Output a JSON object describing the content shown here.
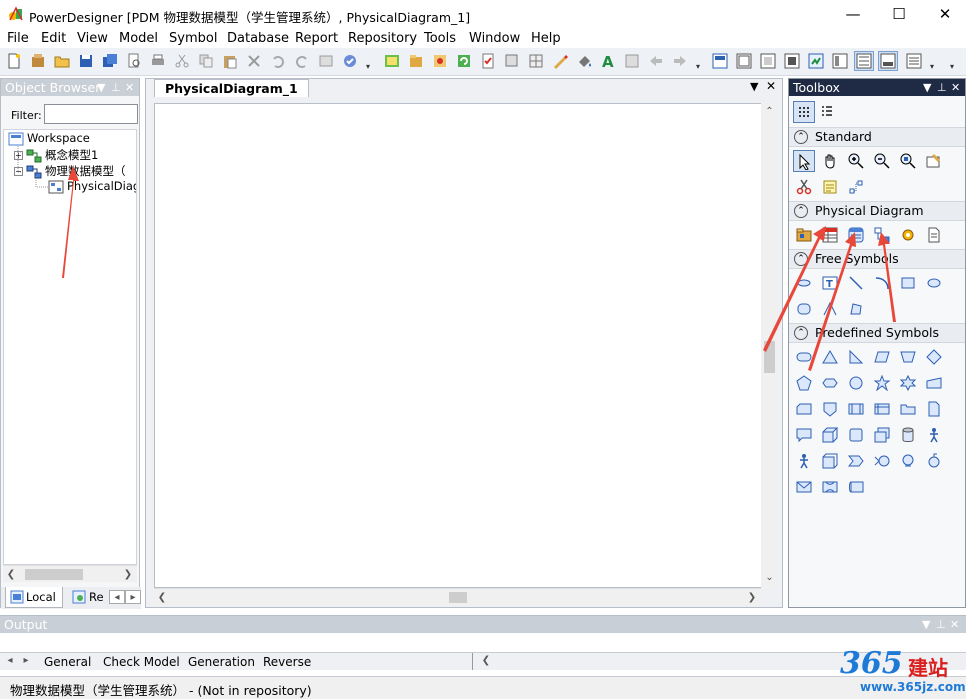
{
  "window": {
    "title": "PowerDesigner [PDM 物理数据模型（学生管理系统）, PhysicalDiagram_1]",
    "minimize": "—",
    "maximize": "☐",
    "close": "✕"
  },
  "menu": [
    "File",
    "Edit",
    "View",
    "Model",
    "Symbol",
    "Database",
    "Report",
    "Repository",
    "Tools",
    "Window",
    "Help"
  ],
  "object_browser": {
    "title": "Object Browser",
    "filter_label": "Filter:",
    "filter_value": "",
    "tree": {
      "root": "Workspace",
      "items": [
        "概念模型1",
        "物理数据模型（",
        "PhysicalDiagra"
      ]
    },
    "tabs": [
      "Local",
      "Re"
    ]
  },
  "document": {
    "tab": "PhysicalDiagram_1"
  },
  "toolbox": {
    "title": "Toolbox",
    "sections": [
      "Standard",
      "Physical Diagram",
      "Free Symbols",
      "Predefined Symbols"
    ],
    "standard_icons": [
      "pointer-icon",
      "hand-icon",
      "zoom-in-icon",
      "zoom-out-icon",
      "zoom-fit-icon",
      "properties-icon",
      "cut-icon",
      "note-icon",
      "link-icon"
    ],
    "physical_icons": [
      "package-icon",
      "table-icon",
      "view-icon",
      "reference-icon",
      "procedure-icon",
      "file-icon"
    ]
  },
  "output": {
    "title": "Output",
    "tabs": [
      "General",
      "Check Model",
      "Generation",
      "Reverse"
    ]
  },
  "status": {
    "text": "物理数据模型（学生管理系统） - (Not in repository)"
  },
  "watermark": {
    "number": "365",
    "chinese": "建站",
    "url": "www.365jz.com"
  },
  "colors": {
    "accent": "#1f2a44",
    "arrow": "#e8483a"
  }
}
